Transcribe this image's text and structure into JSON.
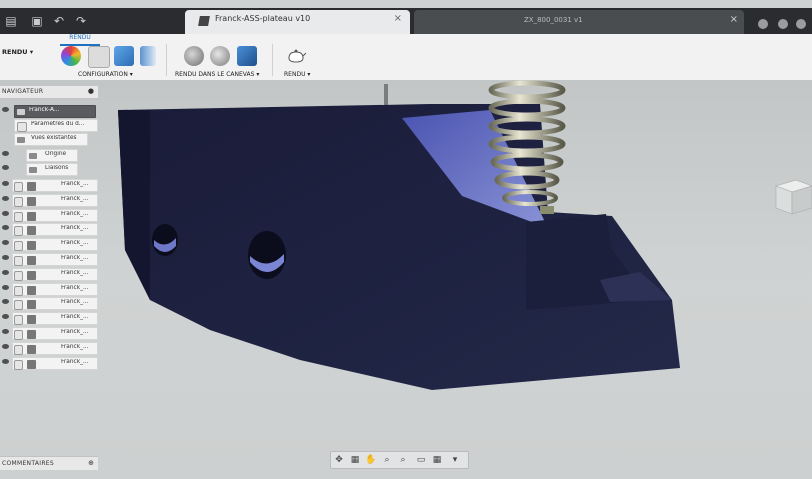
{
  "app": {
    "tabs": [
      {
        "label": "Franck-ASS-plateau v10",
        "active": true
      },
      {
        "label": "ZX_800_0031 v1",
        "active": false
      }
    ]
  },
  "ribbon": {
    "workspace": "RENDU",
    "tab": "RENDU",
    "groups": [
      {
        "label": "CONFIGURATION"
      },
      {
        "label": "RENDU DANS LE CANEVAS"
      },
      {
        "label": "RENDU"
      }
    ]
  },
  "browser": {
    "title": "NAVIGATEUR",
    "root": "Franck-A...",
    "items": [
      "Paramètres du d...",
      "Vues existantes",
      "Origine",
      "Liaisons"
    ],
    "components": [
      "Franck_...",
      "Franck_...",
      "Franck_...",
      "Franck_...",
      "Franck_...",
      "Franck_...",
      "Franck_...",
      "Franck_...",
      "Franck_...",
      "Franck_...",
      "Franck_...",
      "Franck_...",
      "Franck_..."
    ]
  },
  "comments": {
    "title": "COMMENTAIRES"
  },
  "colors": {
    "accent": "#1f70c1",
    "model": "#1b1e3b",
    "viewport": "#cbcece"
  }
}
